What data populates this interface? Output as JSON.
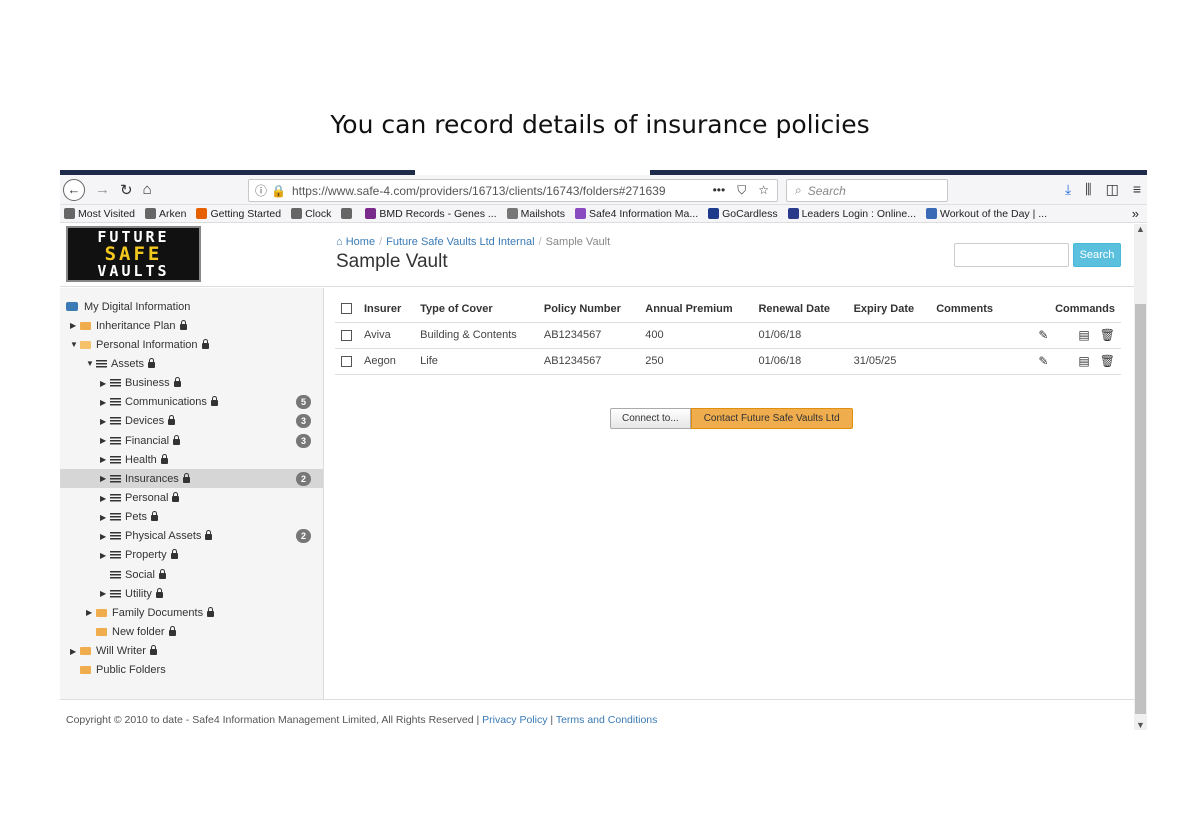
{
  "slide_title": "You can record details of insurance policies",
  "browser": {
    "url": "https://www.safe-4.com/providers/16713/clients/16743/folders#271639",
    "url_menu": "•••",
    "search_placeholder": "Search",
    "bookmarks": [
      {
        "label": "Most Visited",
        "color": "#666"
      },
      {
        "label": "Arken",
        "color": "#666"
      },
      {
        "label": "Getting Started",
        "color": "#e66000"
      },
      {
        "label": "Clock",
        "color": "#666"
      },
      {
        "label": "",
        "color": "#666"
      },
      {
        "label": "BMD Records - Genes ...",
        "color": "#7a2a8a"
      },
      {
        "label": "Mailshots",
        "color": "#777"
      },
      {
        "label": "Safe4 Information Ma...",
        "color": "#8a4ac0"
      },
      {
        "label": "GoCardless",
        "color": "#1e3a8a"
      },
      {
        "label": "Leaders Login : Online...",
        "color": "#2a3a8a"
      },
      {
        "label": "Workout of the Day | ...",
        "color": "#3a6ab5"
      }
    ],
    "bookmarks_more": "»"
  },
  "header": {
    "logo": [
      "FUTURE",
      "SAFE",
      "VAULTS"
    ],
    "breadcrumb": [
      "Home",
      "Future Safe Vaults Ltd Internal",
      "Sample Vault"
    ],
    "page_title": "Sample Vault",
    "search_button": "Search"
  },
  "sidebar": {
    "items": [
      {
        "label": "My Digital Information",
        "icon": "briefcase-icon",
        "caret": "",
        "lock": false,
        "badge": ""
      },
      {
        "label": "Inheritance Plan",
        "icon": "folder-icon",
        "caret": "▶",
        "lock": true,
        "badge": ""
      },
      {
        "label": "Personal Information",
        "icon": "folder-open-icon",
        "caret": "▼",
        "lock": true,
        "badge": ""
      },
      {
        "label": "Assets",
        "icon": "list-icon",
        "caret": "▼",
        "lock": true,
        "badge": ""
      },
      {
        "label": "Business",
        "icon": "list-icon",
        "caret": "▶",
        "lock": true,
        "badge": ""
      },
      {
        "label": "Communications",
        "icon": "list-icon",
        "caret": "▶",
        "lock": true,
        "badge": "5"
      },
      {
        "label": "Devices",
        "icon": "list-icon",
        "caret": "▶",
        "lock": true,
        "badge": "3"
      },
      {
        "label": "Financial",
        "icon": "list-icon",
        "caret": "▶",
        "lock": true,
        "badge": "3"
      },
      {
        "label": "Health",
        "icon": "list-icon",
        "caret": "▶",
        "lock": true,
        "badge": ""
      },
      {
        "label": "Insurances",
        "icon": "list-icon",
        "caret": "▶",
        "lock": true,
        "badge": "2",
        "selected": true
      },
      {
        "label": "Personal",
        "icon": "list-icon",
        "caret": "▶",
        "lock": true,
        "badge": ""
      },
      {
        "label": "Pets",
        "icon": "list-icon",
        "caret": "▶",
        "lock": true,
        "badge": ""
      },
      {
        "label": "Physical Assets",
        "icon": "list-icon",
        "caret": "▶",
        "lock": true,
        "badge": "2"
      },
      {
        "label": "Property",
        "icon": "list-icon",
        "caret": "▶",
        "lock": true,
        "badge": ""
      },
      {
        "label": "Social",
        "icon": "list-icon",
        "caret": "",
        "lock": true,
        "badge": ""
      },
      {
        "label": "Utility",
        "icon": "list-icon",
        "caret": "▶",
        "lock": true,
        "badge": ""
      },
      {
        "label": "Family Documents",
        "icon": "folder-icon",
        "caret": "▶",
        "lock": true,
        "badge": ""
      },
      {
        "label": "New folder",
        "icon": "folder-icon",
        "caret": "",
        "lock": true,
        "badge": ""
      },
      {
        "label": "Will Writer",
        "icon": "folder-icon",
        "caret": "▶",
        "lock": true,
        "badge": ""
      },
      {
        "label": "Public Folders",
        "icon": "folder-icon",
        "caret": "",
        "lock": false,
        "badge": ""
      }
    ]
  },
  "table": {
    "columns": [
      "Insurer",
      "Type of Cover",
      "Policy Number",
      "Annual Premium",
      "Renewal Date",
      "Expiry Date",
      "Comments",
      "Commands"
    ],
    "rows": [
      {
        "insurer": "Aviva",
        "cover": "Building & Contents",
        "policy": "AB1234567",
        "premium": "400",
        "renewal": "01/06/18",
        "expiry": "",
        "comments": ""
      },
      {
        "insurer": "Aegon",
        "cover": "Life",
        "policy": "AB1234567",
        "premium": "250",
        "renewal": "01/06/18",
        "expiry": "31/05/25",
        "comments": ""
      }
    ]
  },
  "actions": {
    "connect": "Connect to...",
    "contact": "Contact Future Safe Vaults Ltd"
  },
  "footer": {
    "copyright": "Copyright © 2010 to date - Safe4 Information Management Limited, All Rights Reserved | ",
    "privacy": "Privacy Policy",
    "sep": " | ",
    "terms": "Terms and Conditions"
  }
}
